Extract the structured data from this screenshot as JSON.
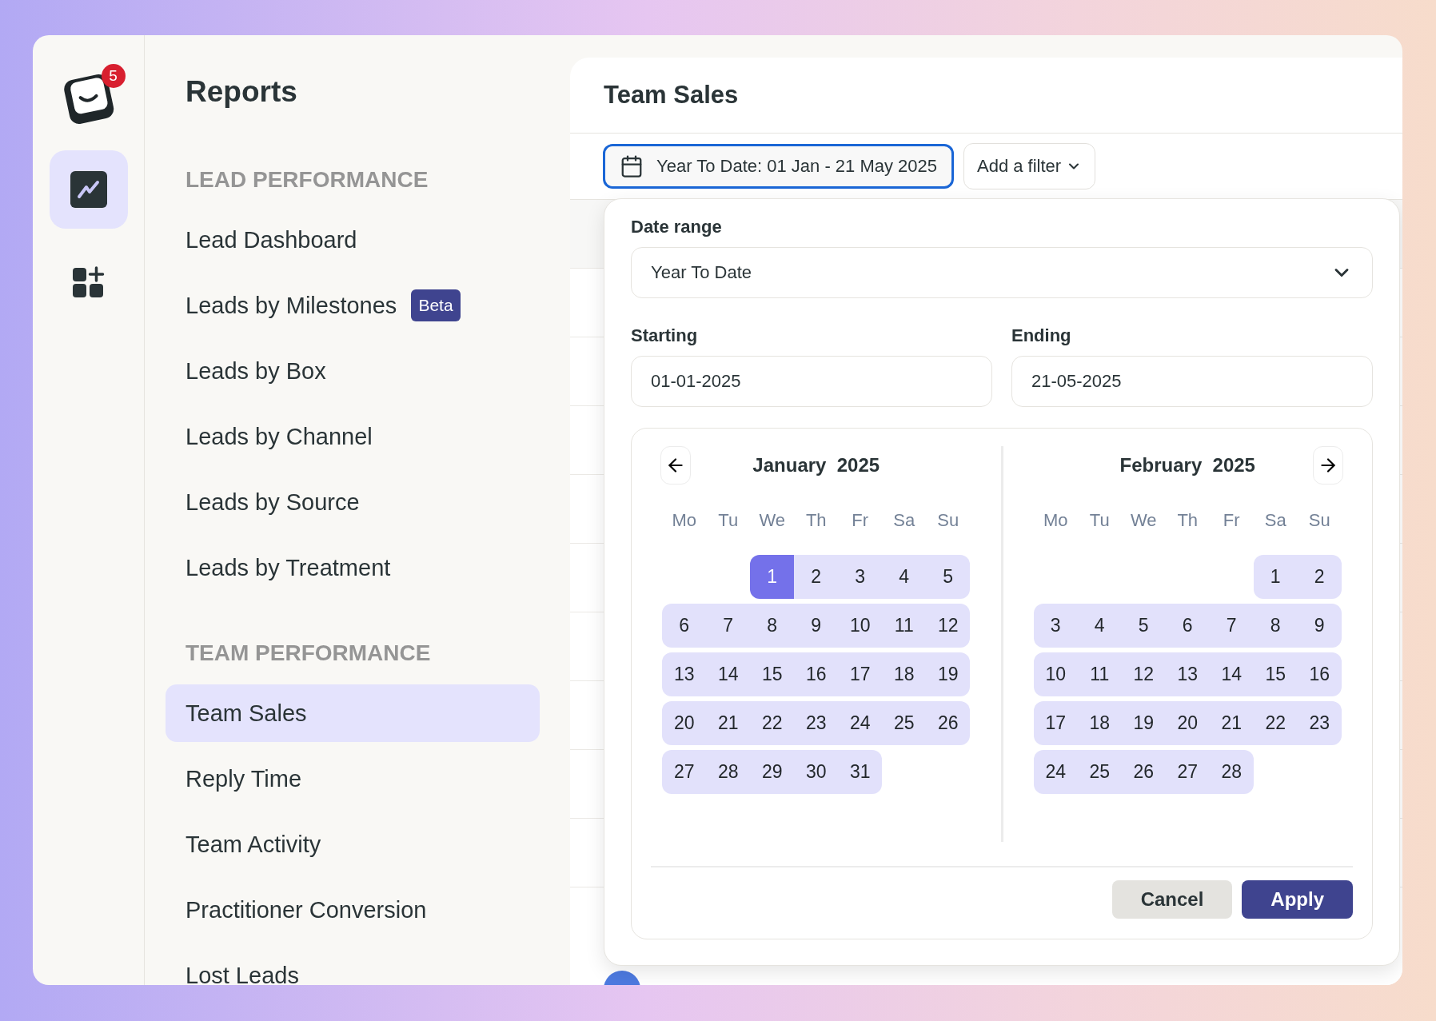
{
  "rail": {
    "badge": "5",
    "items": [
      {
        "kind": "chart",
        "selected": true
      },
      {
        "kind": "apps",
        "selected": false
      }
    ]
  },
  "sidebar": {
    "title": "Reports",
    "sections": [
      {
        "heading": "LEAD PERFORMANCE",
        "items": [
          {
            "label": "Lead Dashboard",
            "selected": false
          },
          {
            "label": "Leads by Milestones",
            "badge": "Beta",
            "selected": false
          },
          {
            "label": "Leads by Box",
            "selected": false
          },
          {
            "label": "Leads by Channel",
            "selected": false
          },
          {
            "label": "Leads by Source",
            "selected": false
          },
          {
            "label": "Leads by Treatment",
            "selected": false
          }
        ]
      },
      {
        "heading": "TEAM PERFORMANCE",
        "items": [
          {
            "label": "Team Sales",
            "selected": true
          },
          {
            "label": "Reply Time",
            "selected": false
          },
          {
            "label": "Team Activity",
            "selected": false
          },
          {
            "label": "Practitioner Conversion",
            "selected": false
          },
          {
            "label": "Lost Leads",
            "selected": false
          }
        ]
      }
    ]
  },
  "main": {
    "title": "Team Sales",
    "date_filter": "Year To Date: 01 Jan - 21 May 2025",
    "add_filter": "Add a filter"
  },
  "popup": {
    "date_range_label": "Date range",
    "date_range_value": "Year To Date",
    "starting_label": "Starting",
    "starting_value": "01-01-2025",
    "ending_label": "Ending",
    "ending_value": "21-05-2025",
    "months": [
      {
        "title": "January  2025",
        "weekdays": [
          "Mo",
          "Tu",
          "We",
          "Th",
          "Fr",
          "Sa",
          "Su"
        ],
        "weeks": [
          [
            {
              "d": "1",
              "selected": true,
              "in_range": true
            },
            {
              "d": "2",
              "selected": false,
              "in_range": true
            },
            {
              "d": "3",
              "selected": false,
              "in_range": true
            },
            {
              "d": "4",
              "selected": false,
              "in_range": true
            },
            {
              "d": "5",
              "selected": false,
              "in_range": true
            }
          ],
          [
            {
              "d": "6",
              "selected": false,
              "in_range": true
            },
            {
              "d": "7",
              "selected": false,
              "in_range": true
            },
            {
              "d": "8",
              "selected": false,
              "in_range": true
            },
            {
              "d": "9",
              "selected": false,
              "in_range": true
            },
            {
              "d": "10",
              "selected": false,
              "in_range": true
            },
            {
              "d": "11",
              "selected": false,
              "in_range": true
            },
            {
              "d": "12",
              "selected": false,
              "in_range": true
            }
          ],
          [
            {
              "d": "13",
              "selected": false,
              "in_range": true
            },
            {
              "d": "14",
              "selected": false,
              "in_range": true
            },
            {
              "d": "15",
              "selected": false,
              "in_range": true
            },
            {
              "d": "16",
              "selected": false,
              "in_range": true
            },
            {
              "d": "17",
              "selected": false,
              "in_range": true
            },
            {
              "d": "18",
              "selected": false,
              "in_range": true
            },
            {
              "d": "19",
              "selected": false,
              "in_range": true
            }
          ],
          [
            {
              "d": "20",
              "selected": false,
              "in_range": true
            },
            {
              "d": "21",
              "selected": false,
              "in_range": true
            },
            {
              "d": "22",
              "selected": false,
              "in_range": true
            },
            {
              "d": "23",
              "selected": false,
              "in_range": true
            },
            {
              "d": "24",
              "selected": false,
              "in_range": true
            },
            {
              "d": "25",
              "selected": false,
              "in_range": true
            },
            {
              "d": "26",
              "selected": false,
              "in_range": true
            }
          ],
          [
            {
              "d": "27",
              "selected": false,
              "in_range": true
            },
            {
              "d": "28",
              "selected": false,
              "in_range": true
            },
            {
              "d": "29",
              "selected": false,
              "in_range": true
            },
            {
              "d": "30",
              "selected": false,
              "in_range": true
            },
            {
              "d": "31",
              "selected": false,
              "in_range": true
            }
          ]
        ]
      },
      {
        "title": "February  2025",
        "weekdays": [
          "Mo",
          "Tu",
          "We",
          "Th",
          "Fr",
          "Sa",
          "Su"
        ],
        "weeks": [
          [
            {
              "d": "1",
              "selected": false,
              "in_range": true
            },
            {
              "d": "2",
              "selected": false,
              "in_range": true
            }
          ],
          [
            {
              "d": "3",
              "selected": false,
              "in_range": true
            },
            {
              "d": "4",
              "selected": false,
              "in_range": true
            },
            {
              "d": "5",
              "selected": false,
              "in_range": true
            },
            {
              "d": "6",
              "selected": false,
              "in_range": true
            },
            {
              "d": "7",
              "selected": false,
              "in_range": true
            },
            {
              "d": "8",
              "selected": false,
              "in_range": true
            },
            {
              "d": "9",
              "selected": false,
              "in_range": true
            }
          ],
          [
            {
              "d": "10",
              "selected": false,
              "in_range": true
            },
            {
              "d": "11",
              "selected": false,
              "in_range": true
            },
            {
              "d": "12",
              "selected": false,
              "in_range": true
            },
            {
              "d": "13",
              "selected": false,
              "in_range": true
            },
            {
              "d": "14",
              "selected": false,
              "in_range": true
            },
            {
              "d": "15",
              "selected": false,
              "in_range": true
            },
            {
              "d": "16",
              "selected": false,
              "in_range": true
            }
          ],
          [
            {
              "d": "17",
              "selected": false,
              "in_range": true
            },
            {
              "d": "18",
              "selected": false,
              "in_range": true
            },
            {
              "d": "19",
              "selected": false,
              "in_range": true
            },
            {
              "d": "20",
              "selected": false,
              "in_range": true
            },
            {
              "d": "21",
              "selected": false,
              "in_range": true
            },
            {
              "d": "22",
              "selected": false,
              "in_range": true
            },
            {
              "d": "23",
              "selected": false,
              "in_range": true
            }
          ],
          [
            {
              "d": "24",
              "selected": false,
              "in_range": true
            },
            {
              "d": "25",
              "selected": false,
              "in_range": true
            },
            {
              "d": "26",
              "selected": false,
              "in_range": true
            },
            {
              "d": "27",
              "selected": false,
              "in_range": true
            },
            {
              "d": "28",
              "selected": false,
              "in_range": true
            }
          ]
        ]
      }
    ],
    "buttons": [
      {
        "kind": "secondary",
        "label": "Cancel"
      },
      {
        "kind": "primary",
        "label": "Apply"
      }
    ]
  }
}
